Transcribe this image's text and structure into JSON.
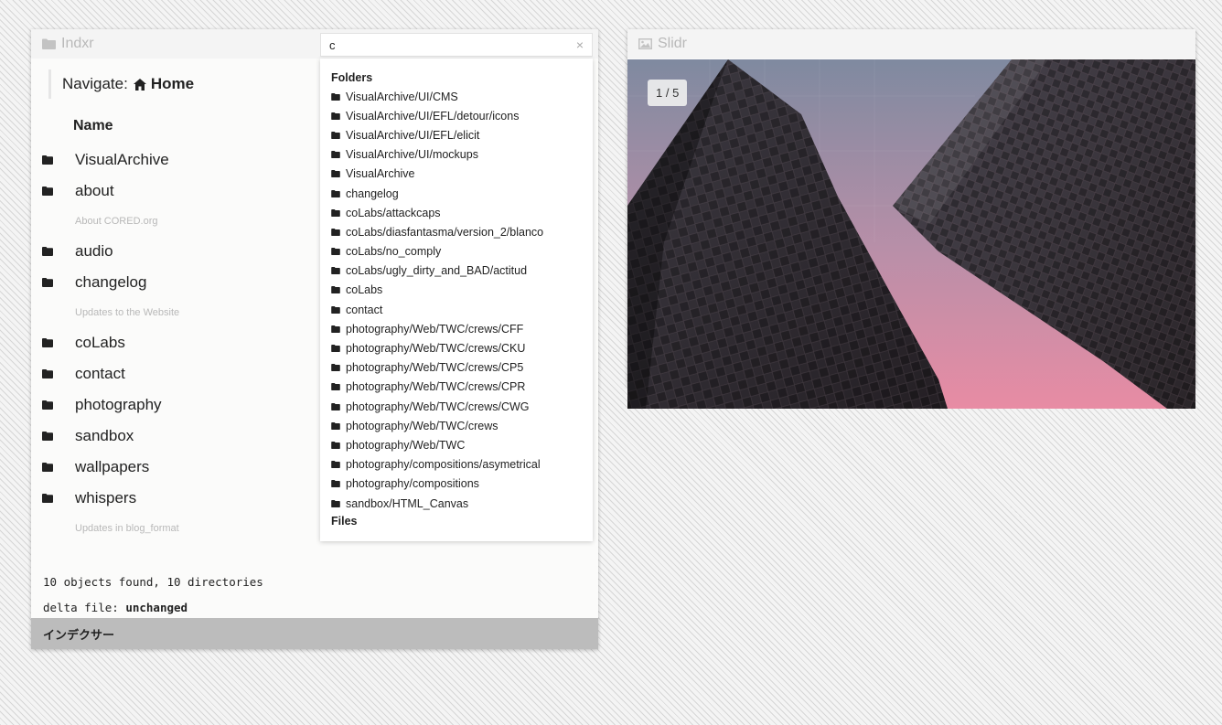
{
  "indxr": {
    "title": "Indxr",
    "navigate_label": "Navigate:",
    "home_label": "Home",
    "name_header": "Name",
    "items": [
      {
        "label": "VisualArchive",
        "desc": ""
      },
      {
        "label": "about",
        "desc": "About CORED.org"
      },
      {
        "label": "audio",
        "desc": ""
      },
      {
        "label": "changelog",
        "desc": "Updates to the Website"
      },
      {
        "label": "coLabs",
        "desc": ""
      },
      {
        "label": "contact",
        "desc": ""
      },
      {
        "label": "photography",
        "desc": ""
      },
      {
        "label": "sandbox",
        "desc": ""
      },
      {
        "label": "wallpapers",
        "desc": ""
      },
      {
        "label": "whispers",
        "desc": "Updates in blog_format"
      }
    ],
    "stats_line": "10 objects found, 10 directories",
    "delta_label": "delta file:",
    "delta_value": "unchanged",
    "footer": "インデクサー"
  },
  "search": {
    "value": "c",
    "clear_glyph": "×",
    "folders_header": "Folders",
    "files_header": "Files",
    "results": [
      "VisualArchive/UI/CMS",
      "VisualArchive/UI/EFL/detour/icons",
      "VisualArchive/UI/EFL/elicit",
      "VisualArchive/UI/mockups",
      "VisualArchive",
      "changelog",
      "coLabs/attackcaps",
      "coLabs/diasfantasma/version_2/blanco",
      "coLabs/no_comply",
      "coLabs/ugly_dirty_and_BAD/actitud",
      "coLabs",
      "contact",
      "photography/Web/TWC/crews/CFF",
      "photography/Web/TWC/crews/CKU",
      "photography/Web/TWC/crews/CP5",
      "photography/Web/TWC/crews/CPR",
      "photography/Web/TWC/crews/CWG",
      "photography/Web/TWC/crews",
      "photography/Web/TWC",
      "photography/compositions/asymetrical",
      "photography/compositions",
      "sandbox/HTML_Canvas"
    ]
  },
  "slidr": {
    "title": "Slidr",
    "counter": "1 / 5"
  },
  "colors": {
    "folder_icon": "#222222",
    "header_text": "#b9b9b9",
    "footer_bg": "#bcbcbc",
    "sky_top": "#7f8aa0",
    "sky_bottom": "#e68fa6"
  }
}
